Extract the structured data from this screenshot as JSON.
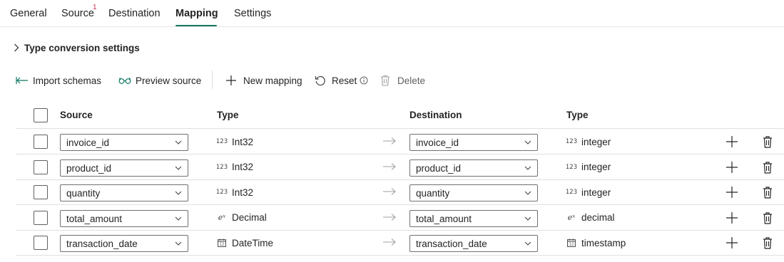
{
  "tabs": [
    {
      "label": "General"
    },
    {
      "label": "Source",
      "badge": "1"
    },
    {
      "label": "Destination"
    },
    {
      "label": "Mapping",
      "active": true
    },
    {
      "label": "Settings"
    }
  ],
  "type_conversion": {
    "label": "Type conversion settings"
  },
  "toolbar": {
    "import_schemas": "Import schemas",
    "preview_source": "Preview source",
    "new_mapping": "New mapping",
    "reset": "Reset",
    "delete": "Delete"
  },
  "table": {
    "headers": {
      "source": "Source",
      "source_type": "Type",
      "destination": "Destination",
      "destination_type": "Type"
    },
    "rows": [
      {
        "source": "invoice_id",
        "source_type": "Int32",
        "source_type_icon": "123",
        "destination": "invoice_id",
        "destination_type": "integer",
        "destination_type_icon": "123"
      },
      {
        "source": "product_id",
        "source_type": "Int32",
        "source_type_icon": "123",
        "destination": "product_id",
        "destination_type": "integer",
        "destination_type_icon": "123"
      },
      {
        "source": "quantity",
        "source_type": "Int32",
        "source_type_icon": "123",
        "destination": "quantity",
        "destination_type": "integer",
        "destination_type_icon": "123"
      },
      {
        "source": "total_amount",
        "source_type": "Decimal",
        "source_type_icon": "eˣ",
        "destination": "total_amount",
        "destination_type": "decimal",
        "destination_type_icon": "eˣ"
      },
      {
        "source": "transaction_date",
        "source_type": "DateTime",
        "source_type_icon": "calendar-icon",
        "destination": "transaction_date",
        "destination_type": "timestamp",
        "destination_type_icon": "calendar-icon"
      }
    ]
  },
  "colors": {
    "accent": "#117865",
    "badge": "#c4314b"
  }
}
